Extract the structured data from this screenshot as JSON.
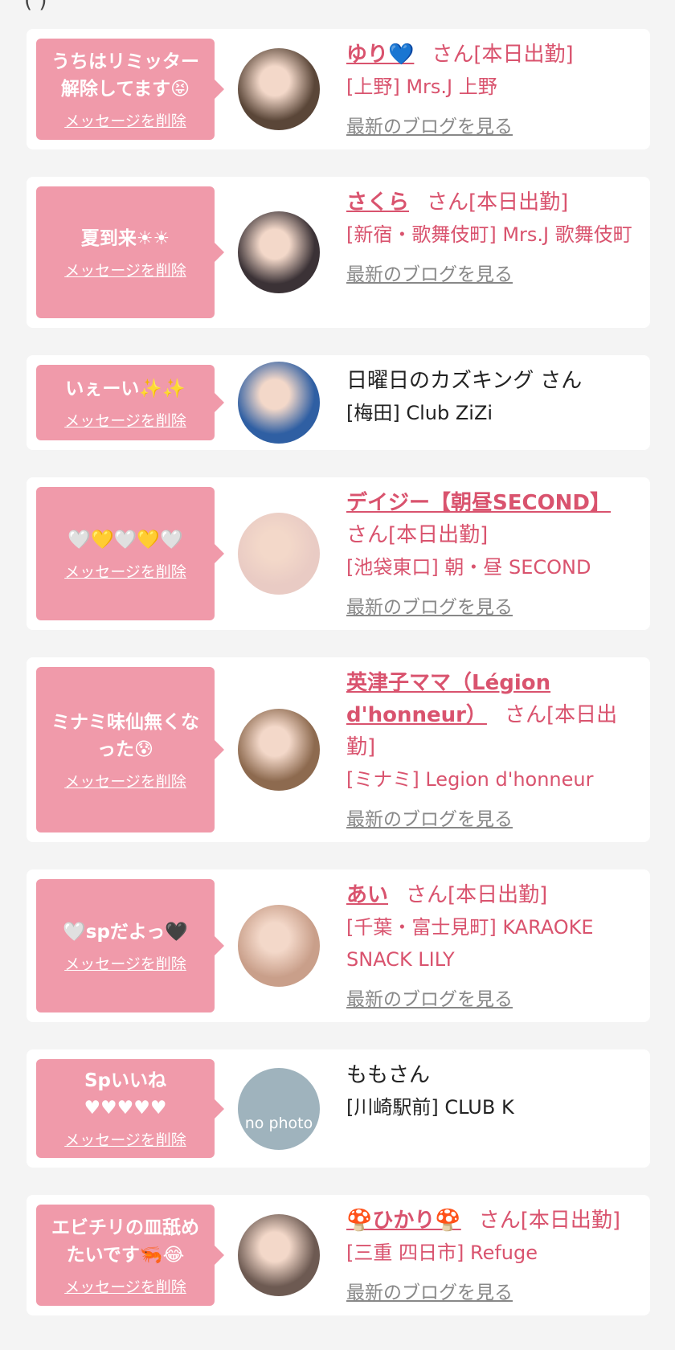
{
  "top_fragment": "(      )",
  "entries": [
    {
      "message": "うちはリミッター\n解除してます😝",
      "delete_label": "メッセージを削除",
      "name": "ゆり💙",
      "name_link": true,
      "suffix": "さん[本日出勤]",
      "shop": "[上野] Mrs.J 上野",
      "blog": "最新のブログを見る",
      "avatar_color": "#5a4638"
    },
    {
      "message": "夏到来☀☀",
      "delete_label": "メッセージを削除",
      "name": "さくら",
      "name_link": true,
      "suffix": "さん[本日出勤]",
      "shop": "[新宿・歌舞伎町] Mrs.J 歌舞伎町",
      "blog": "最新のブログを見る",
      "avatar_color": "#3b3236"
    },
    {
      "message": "いぇーい✨✨",
      "delete_label": "メッセージを削除",
      "name": "日曜日のカズキング",
      "name_link": false,
      "suffix": "さん",
      "shop": "[梅田] Club ZiZi",
      "blog": "",
      "avatar_color": "#2f5fa3"
    },
    {
      "message": "🤍💛🤍💛🤍",
      "delete_label": "メッセージを削除",
      "name": "デイジー【朝昼SECOND】",
      "name_link": true,
      "suffix": "さん[本日出勤]",
      "shop": "[池袋東口] 朝・昼 SECOND",
      "blog": "最新のブログを見る",
      "avatar_color": "#e9cbc4"
    },
    {
      "message": "ミナミ味仙無くな\nった😰",
      "delete_label": "メッセージを削除",
      "name": "英津子ママ（Légion d'honneur）",
      "name_link": true,
      "suffix": "さん[本日出勤]",
      "shop": "[ミナミ] Legion d'honneur",
      "blog": "最新のブログを見る",
      "avatar_color": "#8d6a4f"
    },
    {
      "message": "🤍spだよっ🖤",
      "delete_label": "メッセージを削除",
      "name": "あい",
      "name_link": true,
      "suffix": "さん[本日出勤]",
      "shop": "[千葉・富士見町] KARAOKE SNACK LILY",
      "blog": "最新のブログを見る",
      "avatar_color": "#c99f8a"
    },
    {
      "message": "Spいいね\n♥♥♥♥♥",
      "delete_label": "メッセージを削除",
      "name": "ももさん",
      "name_link": false,
      "suffix": "",
      "shop": "[川崎駅前] CLUB K",
      "blog": "",
      "avatar_color": "#9fb3bd",
      "avatar_text": "no photo"
    },
    {
      "message": "エビチリの皿舐め\nたいです🦐😂",
      "delete_label": "メッセージを削除",
      "name": "🍄ひかり🍄",
      "name_link": true,
      "suffix": "さん[本日出勤]",
      "shop": "[三重 四日市] Refuge",
      "blog": "最新のブログを見る",
      "avatar_color": "#6d5a52"
    }
  ]
}
